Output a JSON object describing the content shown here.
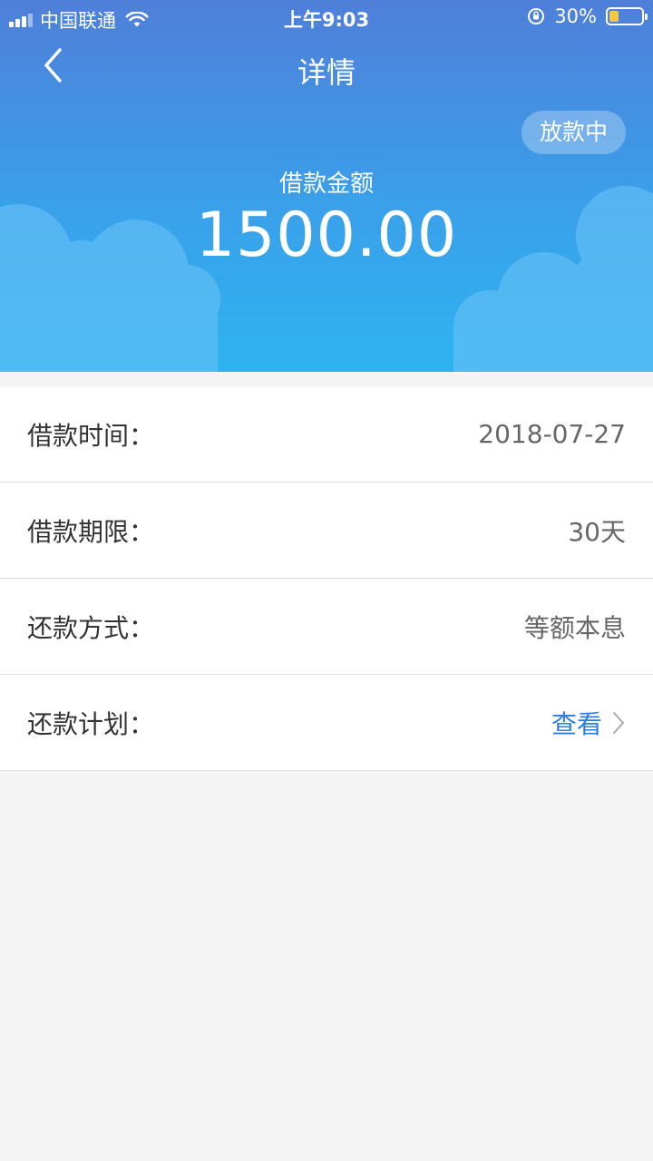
{
  "status_bar": {
    "carrier": "中国联通",
    "time": "上午9:03",
    "battery": "30%",
    "battery_level": 0.3
  },
  "nav": {
    "title": "详情"
  },
  "loan": {
    "status": "放款中",
    "amount_label": "借款金额",
    "amount": "1500.00"
  },
  "details": [
    {
      "label": "借款时间：",
      "value": "2018-07-27"
    },
    {
      "label": "借款期限：",
      "value": "30天"
    },
    {
      "label": "还款方式：",
      "value": "等额本息"
    },
    {
      "label": "还款计划：",
      "value": "查看"
    }
  ],
  "colors": {
    "header_top": "#4f7fd9",
    "header_bottom": "#2fb3f0",
    "link": "#2d7ee0",
    "battery_fill": "#f6c744"
  }
}
